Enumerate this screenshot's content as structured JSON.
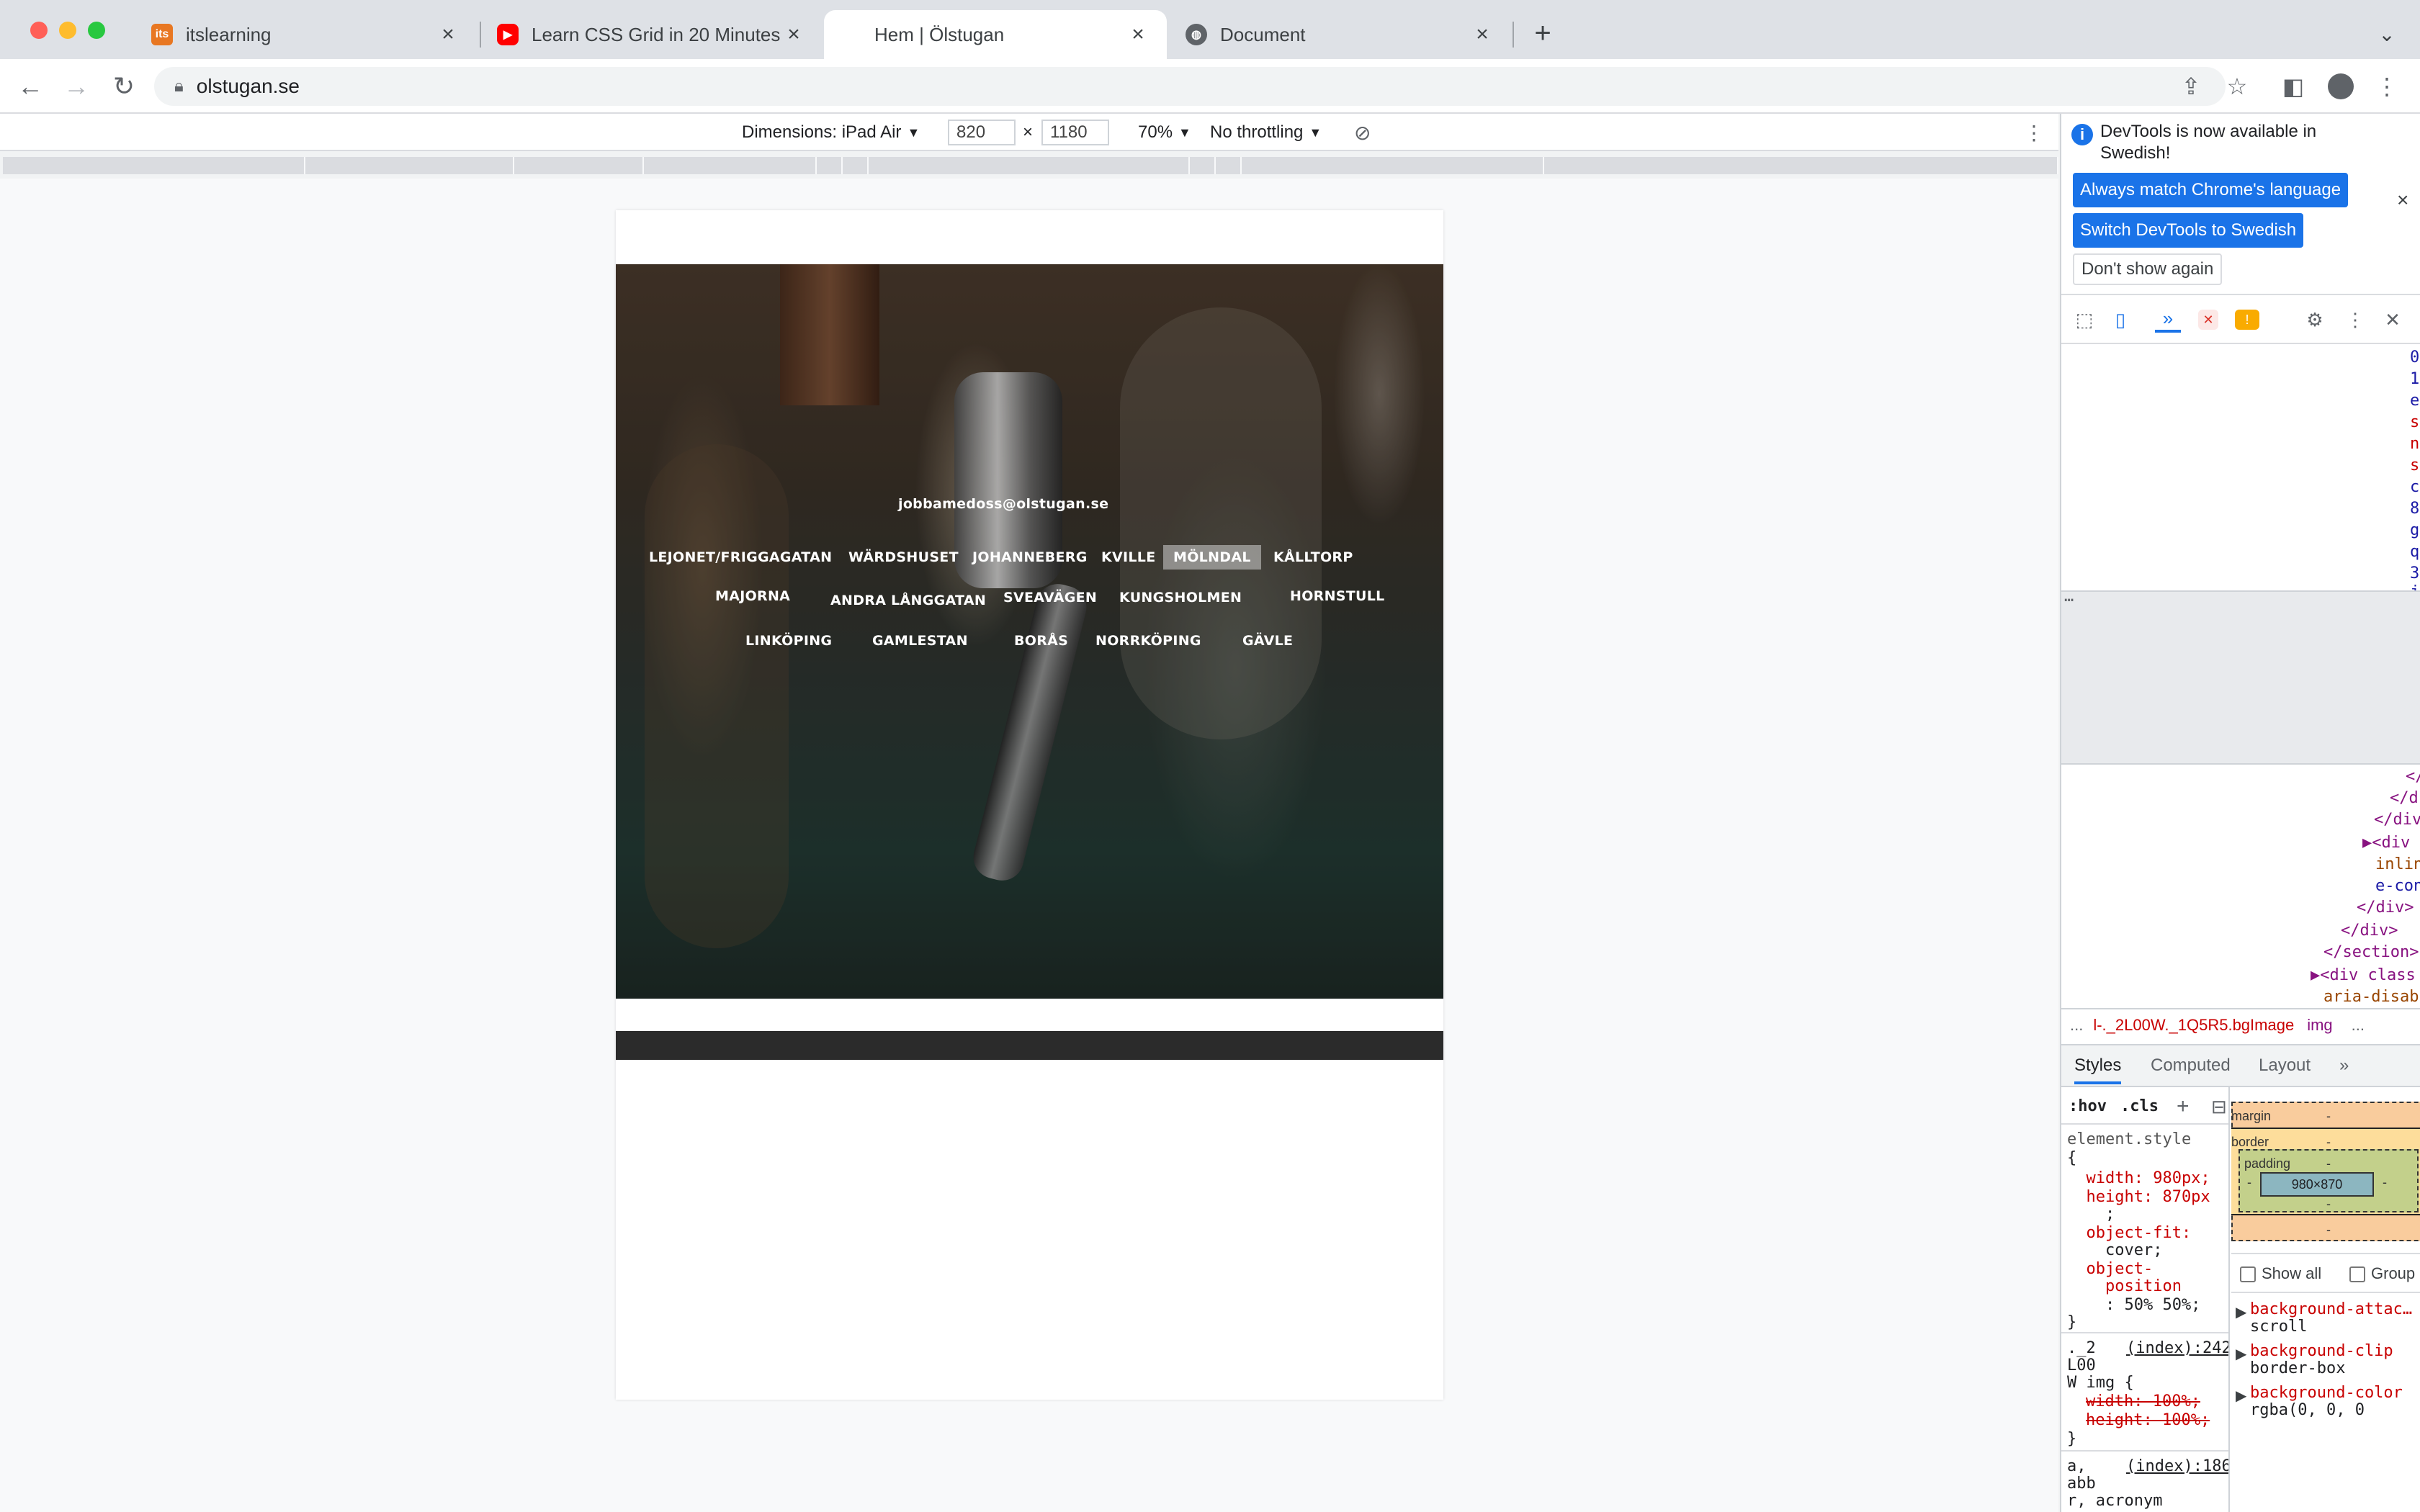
{
  "tabs": [
    {
      "title": "itslearning",
      "favicon": "its"
    },
    {
      "title": "Learn CSS Grid in 20 Minutes - ",
      "favicon": "youtube-icon"
    },
    {
      "title": "Hem | Ölstugan",
      "favicon": ""
    },
    {
      "title": "Document",
      "favicon": "globe-icon"
    }
  ],
  "omnibox": {
    "url": "olstugan.se"
  },
  "device_toolbar": {
    "dimensions_label": "Dimensions: iPad Air",
    "width": "820",
    "x_sep": "×",
    "height": "1180",
    "zoom": "70%",
    "throttling": "No throttling"
  },
  "site": {
    "email": "jobbamedoss@olstugan.se",
    "menu_row1": [
      "LEJONET/FRIGGAGATAN",
      "WÄRDSHUSET",
      "JOHANNEBERG",
      "KVILLE",
      "MÖLNDAL",
      "KÅLLTORP"
    ],
    "menu_row2": [
      "MAJORNA",
      "ANDRA LÅNGGATAN",
      "SVEAVÄGEN",
      "KUNGSHOLMEN",
      "HORNSTULL"
    ],
    "menu_row3": [
      "LINKÖPING",
      "GAMLESTAN",
      "BORÅS",
      "NORRKÖPING",
      "GÄVLE"
    ]
  },
  "devtools": {
    "info_text": "DevTools is now available in Swedish!",
    "btn_match": "Always match Chrome's language",
    "btn_switch": "Switch DevTools to Swedish",
    "btn_dont": "Don't show again",
    "top_chars": [
      "0",
      "1",
      "e",
      "s",
      "n",
      "s",
      "c",
      "8",
      "g",
      "q",
      "3",
      "j"
    ],
    "ellipsis": "…",
    "elements": [
      "</",
      "</d",
      "</div",
      "▶<div",
      "inlin",
      "e-con",
      "</div>",
      "</div>",
      "</section>",
      "▶<div class",
      "aria-disab"
    ],
    "crumb_dots": "...",
    "crumb_class": "l-._2L00W._1Q5R5.bgImage",
    "crumb_tag": "img",
    "crumb_more": "...",
    "panel_tabs": [
      "Styles",
      "Computed",
      "Layout",
      "»"
    ],
    "filter_hov": ":hov",
    "filter_cls": ".cls",
    "style_lines": [
      "element.style",
      "{",
      "  width: 980px;",
      "  height: 870px",
      "    ;",
      "  object-fit:",
      "    cover;",
      "  object-",
      "    position",
      "    : 50% 50%;",
      "}"
    ],
    "rule2_selector": "._2",
    "rule2_selector2": "L00",
    "rule2_selector3": "W img {",
    "rule2_src": "(index):242",
    "rule2_width": "width: 100%;",
    "rule2_height": "height: 100%;",
    "rule2_close": "}",
    "rule3_selector": "a,",
    "rule3_selector2": "abb",
    "rule3_selector3": "r, acronym",
    "rule3_src": "(index):186",
    "box": {
      "margin": "margin",
      "border": "border",
      "padding": "padding",
      "content": "980×870",
      "dash": "-"
    },
    "show_all": "Show all",
    "group": "Group",
    "computed": [
      {
        "prop": "background-attac…",
        "val": "scroll"
      },
      {
        "prop": "background-clip",
        "val": "border-box"
      },
      {
        "prop": "background-color",
        "val": "rgba(0, 0, 0"
      }
    ]
  },
  "colors": {
    "accent": "#1a73e8",
    "tabstrip": "#dee1e6",
    "traffic_red": "#ff5f57",
    "traffic_yellow": "#febc2e",
    "traffic_green": "#28c840"
  }
}
